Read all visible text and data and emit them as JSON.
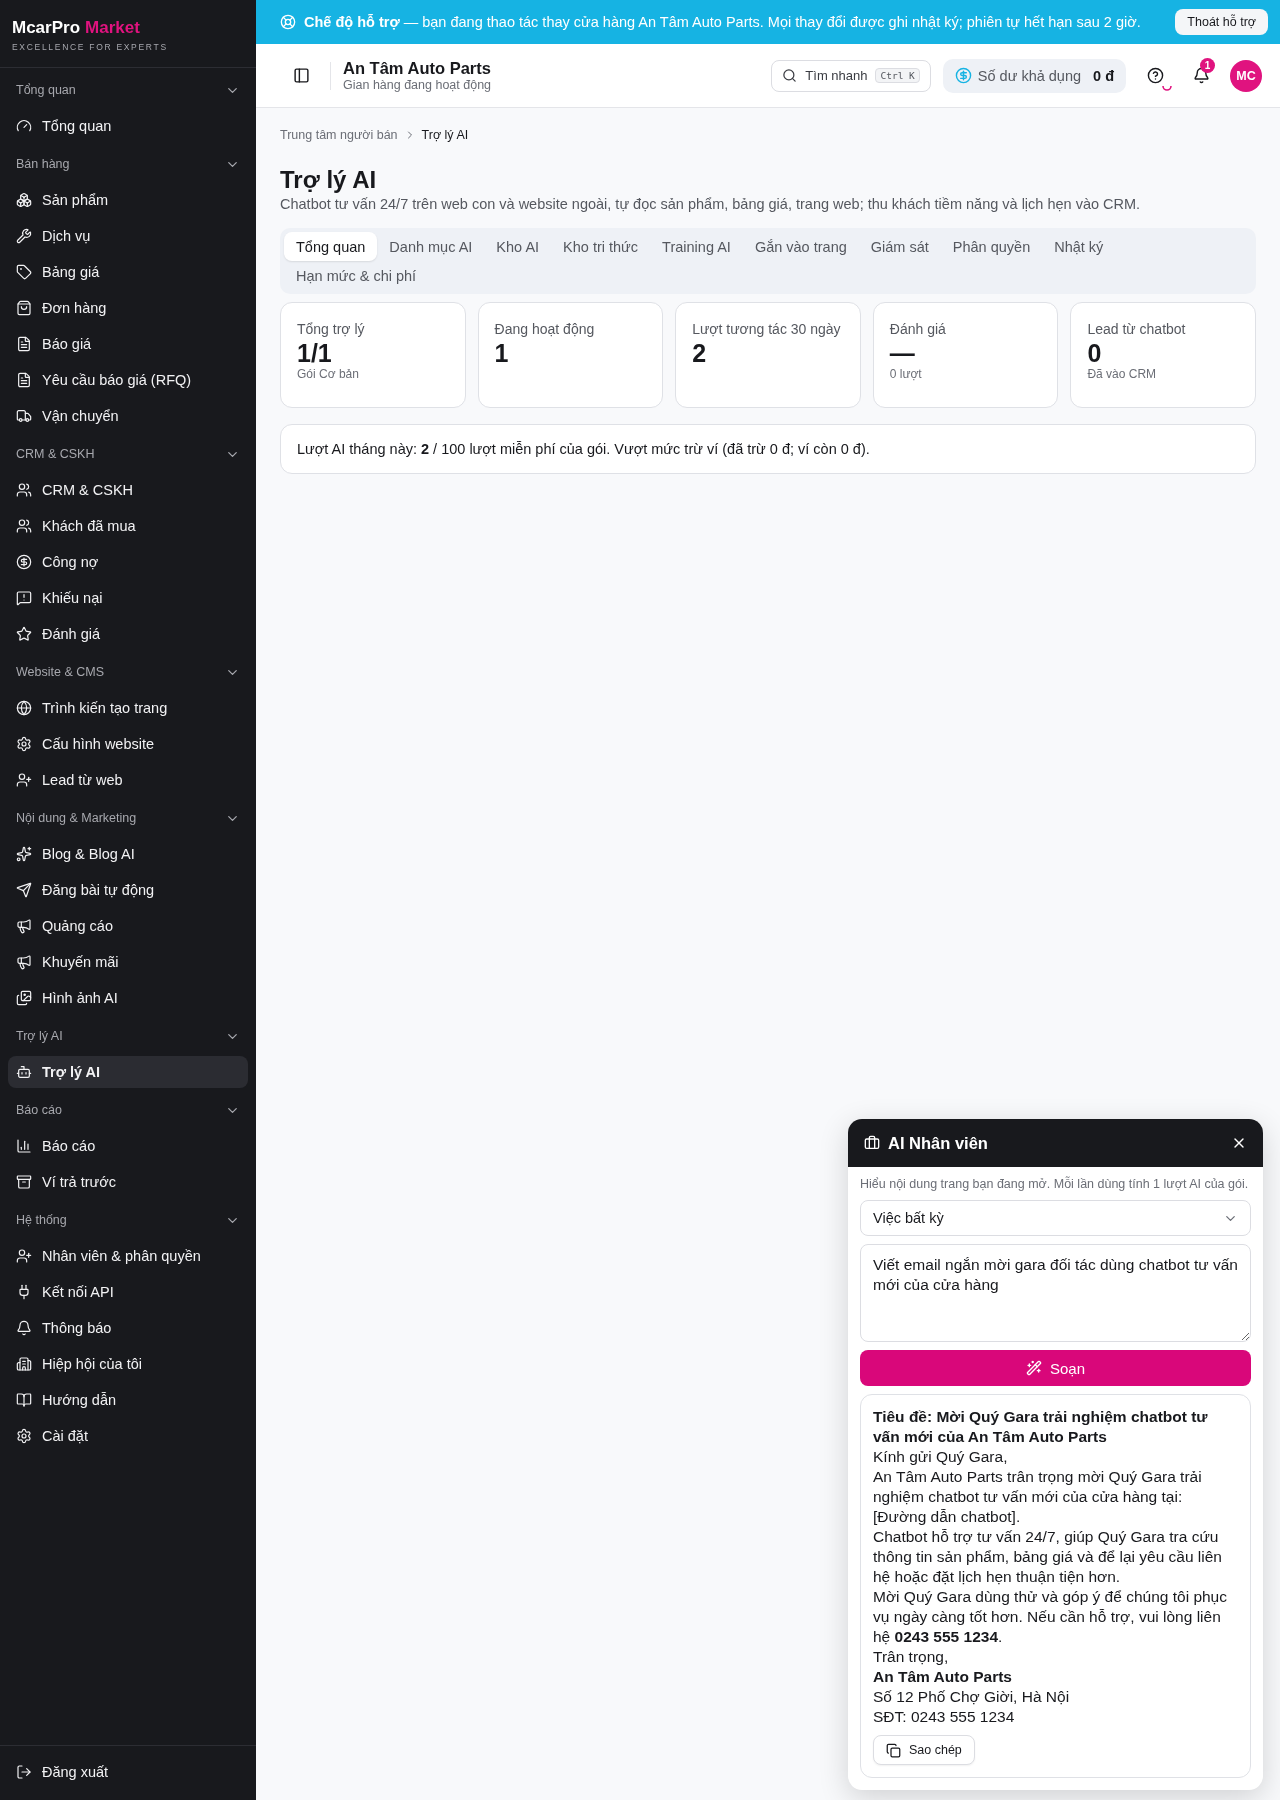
{
  "sidebar": {
    "brand": {
      "name": "McarPro",
      "accent": "Market",
      "tagline": "EXCELLENCE FOR EXPERTS"
    },
    "sections": [
      {
        "title": "Tổng quan",
        "expanded": true,
        "items": [
          {
            "label": "Tổng quan",
            "selected": false
          }
        ]
      },
      {
        "title": "Bán hàng",
        "expanded": true,
        "items": [
          {
            "label": "Sản phẩm",
            "selected": false
          },
          {
            "label": "Dịch vụ",
            "selected": false
          },
          {
            "label": "Bảng giá",
            "selected": false
          },
          {
            "label": "Đơn hàng",
            "selected": false
          },
          {
            "label": "Báo giá",
            "selected": false
          },
          {
            "label": "Yêu cầu báo giá (RFQ)",
            "selected": false
          },
          {
            "label": "Vận chuyển",
            "selected": false
          }
        ]
      },
      {
        "title": "CRM & CSKH",
        "expanded": true,
        "items": [
          {
            "label": "CRM & CSKH",
            "selected": false
          },
          {
            "label": "Khách đã mua",
            "selected": false
          },
          {
            "label": "Công nợ",
            "selected": false
          },
          {
            "label": "Khiếu nại",
            "selected": false
          },
          {
            "label": "Đánh giá",
            "selected": false
          }
        ]
      },
      {
        "title": "Website & CMS",
        "expanded": true,
        "items": [
          {
            "label": "Trình kiến tạo trang",
            "selected": false
          },
          {
            "label": "Cấu hình website",
            "selected": false
          },
          {
            "label": "Lead từ web",
            "selected": false
          }
        ]
      },
      {
        "title": "Nội dung & Marketing",
        "expanded": true,
        "items": [
          {
            "label": "Blog & Blog AI",
            "selected": false
          },
          {
            "label": "Đăng bài tự động",
            "selected": false
          },
          {
            "label": "Quảng cáo",
            "selected": false
          },
          {
            "label": "Khuyến mãi",
            "selected": false
          },
          {
            "label": "Hình ảnh AI",
            "selected": false
          }
        ]
      },
      {
        "title": "Trợ lý AI",
        "expanded": true,
        "items": [
          {
            "label": "Trợ lý AI",
            "selected": true
          }
        ]
      },
      {
        "title": "Báo cáo",
        "expanded": true,
        "items": [
          {
            "label": "Báo cáo",
            "selected": false
          },
          {
            "label": "Ví trả trước",
            "selected": false
          }
        ]
      },
      {
        "title": "Hệ thống",
        "expanded": true,
        "items": [
          {
            "label": "Nhân viên & phân quyền",
            "selected": false
          },
          {
            "label": "Kết nối API",
            "selected": false
          },
          {
            "label": "Thông báo",
            "selected": false
          },
          {
            "label": "Hiệp hội của tôi",
            "selected": false
          },
          {
            "label": "Hướng dẫn",
            "selected": false
          },
          {
            "label": "Cài đặt",
            "selected": false
          }
        ]
      }
    ],
    "logout": "Đăng xuất"
  },
  "banner": {
    "message": "**Chế độ hỗ trợ** — bạn đang thao tác thay cửa hàng An Tâm Auto Parts. Mọi thay đổi được ghi nhật ký; phiên tự hết hạn sau 2 giờ.",
    "button": "Thoát hỗ trợ"
  },
  "header": {
    "store_name": "An Tâm Auto Parts",
    "store_status": "Gian hàng đang hoạt động",
    "search": {
      "placeholder": "Tìm nhanh",
      "shortcut": "Ctrl K"
    },
    "balance": {
      "label": "Số dư khả dụng",
      "value": "0 đ"
    },
    "notifications": "1",
    "avatar": "MC"
  },
  "breadcrumb": [
    "Trung tâm người bán",
    "Trợ lý AI"
  ],
  "page": {
    "title": "Trợ lý AI",
    "subtitle": "Chatbot tư vấn 24/7 trên web con và website ngoài, tự đọc sản phẩm, bảng giá, trang web; thu khách tiềm năng và lịch hẹn vào CRM."
  },
  "tabs": [
    {
      "label": "Tổng quan",
      "selected": true
    },
    {
      "label": "Danh mục AI",
      "selected": false
    },
    {
      "label": "Kho AI",
      "selected": false
    },
    {
      "label": "Kho tri thức",
      "selected": false
    },
    {
      "label": "Training AI",
      "selected": false
    },
    {
      "label": "Gắn vào trang",
      "selected": false
    },
    {
      "label": "Giám sát",
      "selected": false
    },
    {
      "label": "Phân quyền",
      "selected": false
    },
    {
      "label": "Nhật ký",
      "selected": false
    },
    {
      "label": "Hạn mức & chi phí",
      "selected": false
    }
  ],
  "stats": [
    {
      "label": "Tổng trợ lý",
      "value": "1/1",
      "note": "Gói Cơ bản"
    },
    {
      "label": "Đang hoạt động",
      "value": "1"
    },
    {
      "label": "Lượt tương tác 30 ngày",
      "value": "2"
    },
    {
      "label": "Đánh giá",
      "value": "—",
      "note": "0 lượt"
    },
    {
      "label": "Lead từ chatbot",
      "value": "0",
      "note": "Đã vào CRM"
    }
  ],
  "usage_note": "Lượt AI tháng này: **2** / 100 lượt miễn phí của gói. Vượt mức trừ ví (đã trừ 0 đ; ví còn 0 đ).",
  "assistant_panel": {
    "title": "AI Nhân viên",
    "hint": "Hiểu nội dung trang bạn đang mở. Mỗi lần dùng tính 1 lượt AI của gói.",
    "task": "Việc bất kỳ",
    "prompt": "Viết email ngắn mời gara đối tác dùng chatbot tư vấn mới của cửa hàng",
    "compose_button": "Soạn",
    "result": [
      {
        "text": "Tiêu đề: Mời Quý Gara trải nghiệm chatbot tư vấn mới của An Tâm Auto Parts",
        "bold": true
      },
      {
        "text": "Kính gửi Quý Gara,",
        "bold": false
      },
      {
        "text": "An Tâm Auto Parts trân trọng mời Quý Gara trải nghiệm chatbot tư vấn mới của cửa hàng tại: [Đường dẫn chatbot].",
        "bold": false
      },
      {
        "text": "Chatbot hỗ trợ tư vấn 24/7, giúp Quý Gara tra cứu thông tin sản phẩm, bảng giá và để lại yêu cầu liên hệ hoặc đặt lịch hẹn thuận tiện hơn.",
        "bold": false
      },
      {
        "text": "Mời Quý Gara dùng thử và góp ý để chúng tôi phục vụ ngày càng tốt hơn. Nếu cần hỗ trợ, vui lòng liên hệ **0243 555 1234**.",
        "bold": false
      },
      {
        "text": "Trân trọng,",
        "bold": false
      },
      {
        "text": "An Tâm Auto Parts",
        "bold": true
      },
      {
        "text": "Số 12 Phố Chợ Giời, Hà Nội",
        "bold": false
      },
      {
        "text": "SĐT: 0243 555 1234",
        "bold": false
      }
    ],
    "copy_button": "Sao chép"
  }
}
